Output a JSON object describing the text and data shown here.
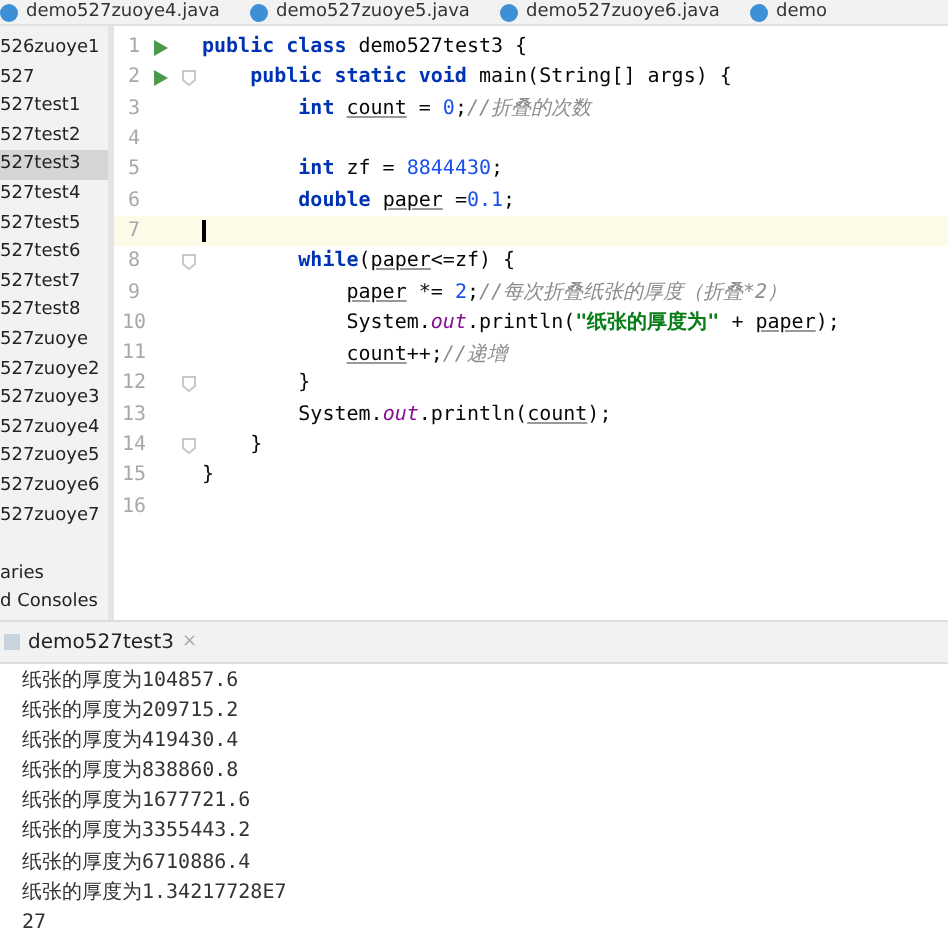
{
  "editor_tabs": [
    {
      "label": "demo527zuoye4.java",
      "selected": false
    },
    {
      "label": "demo527zuoye5.java",
      "selected": false
    },
    {
      "label": "demo527zuoye6.java",
      "selected": false
    },
    {
      "label": "demo",
      "selected": false
    }
  ],
  "project_tree": [
    {
      "label": "526zuoye1",
      "selected": false
    },
    {
      "label": "527",
      "selected": false
    },
    {
      "label": "527test1",
      "selected": false
    },
    {
      "label": "527test2",
      "selected": false
    },
    {
      "label": "527test3",
      "selected": true
    },
    {
      "label": "527test4",
      "selected": false
    },
    {
      "label": "527test5",
      "selected": false
    },
    {
      "label": "527test6",
      "selected": false
    },
    {
      "label": "527test7",
      "selected": false
    },
    {
      "label": "527test8",
      "selected": false
    },
    {
      "label": "527zuoye",
      "selected": false
    },
    {
      "label": "527zuoye2",
      "selected": false
    },
    {
      "label": "527zuoye3",
      "selected": false
    },
    {
      "label": "527zuoye4",
      "selected": false
    },
    {
      "label": "527zuoye5",
      "selected": false
    },
    {
      "label": "527zuoye6",
      "selected": false
    },
    {
      "label": "527zuoye7",
      "selected": false
    }
  ],
  "project_tree_footer": [
    "aries",
    "d Consoles"
  ],
  "code_lines": [
    {
      "number": "1",
      "run": true,
      "fold": false,
      "current": false,
      "tokens": [
        {
          "text": "public class ",
          "kind": "keyword"
        },
        {
          "text": "demo527test3 {",
          "kind": "plain"
        }
      ],
      "children": [
        {
          "number": "2",
          "run": true,
          "fold": true,
          "current": false,
          "tokens": [
            {
              "text": "public static void ",
              "kind": "keyword"
            },
            {
              "text": "main(String[] args) {",
              "kind": "plain"
            }
          ],
          "children": [
            {
              "number": "3",
              "run": false,
              "fold": false,
              "current": false,
              "tokens": [
                {
                  "text": "int ",
                  "kind": "keyword"
                },
                {
                  "text": "count",
                  "kind": "var"
                },
                {
                  "text": " = ",
                  "kind": "plain"
                },
                {
                  "text": "0",
                  "kind": "number"
                },
                {
                  "text": ";",
                  "kind": "plain"
                },
                {
                  "text": "//折叠的次数",
                  "kind": "comment"
                }
              ]
            },
            {
              "number": "4",
              "run": false,
              "fold": false,
              "current": false
            },
            {
              "number": "5",
              "run": false,
              "fold": false,
              "current": false,
              "tokens": [
                {
                  "text": "int ",
                  "kind": "keyword"
                },
                {
                  "text": "zf = ",
                  "kind": "plain"
                },
                {
                  "text": "8844430",
                  "kind": "number"
                },
                {
                  "text": ";",
                  "kind": "plain"
                }
              ]
            },
            {
              "number": "6",
              "run": false,
              "fold": false,
              "current": false,
              "tokens": [
                {
                  "text": "double ",
                  "kind": "keyword"
                },
                {
                  "text": "paper",
                  "kind": "var"
                },
                {
                  "text": " =",
                  "kind": "plain"
                },
                {
                  "text": "0.1",
                  "kind": "number"
                },
                {
                  "text": ";",
                  "kind": "plain"
                }
              ]
            },
            {
              "number": "7",
              "run": false,
              "fold": false,
              "current": true
            },
            {
              "number": "8",
              "run": false,
              "fold": true,
              "current": false,
              "tokens": [
                {
                  "text": "while",
                  "kind": "keyword"
                },
                {
                  "text": "(",
                  "kind": "plain"
                },
                {
                  "text": "paper",
                  "kind": "var"
                },
                {
                  "text": "<=zf) {",
                  "kind": "plain"
                }
              ],
              "children": [
                {
                  "number": "9",
                  "run": false,
                  "fold": false,
                  "current": false,
                  "tokens": [
                    {
                      "text": "paper",
                      "kind": "var"
                    },
                    {
                      "text": " *= ",
                      "kind": "plain"
                    },
                    {
                      "text": "2",
                      "kind": "number"
                    },
                    {
                      "text": ";",
                      "kind": "plain"
                    },
                    {
                      "text": "//每次折叠纸张的厚度（折叠*2）",
                      "kind": "comment"
                    }
                  ]
                },
                {
                  "number": "10",
                  "run": false,
                  "fold": false,
                  "current": false,
                  "tokens": [
                    {
                      "text": "System.",
                      "kind": "plain"
                    },
                    {
                      "text": "out",
                      "kind": "field"
                    },
                    {
                      "text": ".println(",
                      "kind": "plain"
                    },
                    {
                      "text": "\"纸张的厚度为\"",
                      "kind": "string"
                    },
                    {
                      "text": " + ",
                      "kind": "plain"
                    },
                    {
                      "text": "paper",
                      "kind": "var"
                    },
                    {
                      "text": ");",
                      "kind": "plain"
                    }
                  ]
                },
                {
                  "number": "11",
                  "run": false,
                  "fold": false,
                  "current": false,
                  "tokens": [
                    {
                      "text": "count",
                      "kind": "var"
                    },
                    {
                      "text": "++;",
                      "kind": "plain"
                    },
                    {
                      "text": "//递增",
                      "kind": "comment"
                    }
                  ]
                }
              ]
            },
            {
              "number": "12",
              "run": false,
              "fold": true,
              "current": false,
              "tokens": [
                {
                  "text": "}",
                  "kind": "plain"
                }
              ]
            },
            {
              "number": "13",
              "run": false,
              "fold": false,
              "current": false,
              "tokens": [
                {
                  "text": "System.",
                  "kind": "plain"
                },
                {
                  "text": "out",
                  "kind": "field"
                },
                {
                  "text": ".println(",
                  "kind": "plain"
                },
                {
                  "text": "count",
                  "kind": "var"
                },
                {
                  "text": ");",
                  "kind": "plain"
                }
              ]
            }
          ]
        },
        {
          "number": "14",
          "run": false,
          "fold": true,
          "current": false,
          "tokens": [
            {
              "text": "}",
              "kind": "plain"
            }
          ]
        }
      ]
    },
    {
      "number": "15",
      "run": false,
      "fold": false,
      "current": false,
      "tokens": [
        {
          "text": "}",
          "kind": "plain"
        }
      ]
    },
    {
      "number": "16",
      "run": false,
      "fold": false,
      "current": false
    }
  ],
  "run_panel": {
    "tab": "demo527test3",
    "close": "×",
    "output": [
      "纸张的厚度为104857.6",
      "纸张的厚度为209715.2",
      "纸张的厚度为419430.4",
      "纸张的厚度为838860.8",
      "纸张的厚度为1677721.6",
      "纸张的厚度为3355443.2",
      "纸张的厚度为6710886.4",
      "纸张的厚度为1.34217728E7",
      "27"
    ]
  }
}
